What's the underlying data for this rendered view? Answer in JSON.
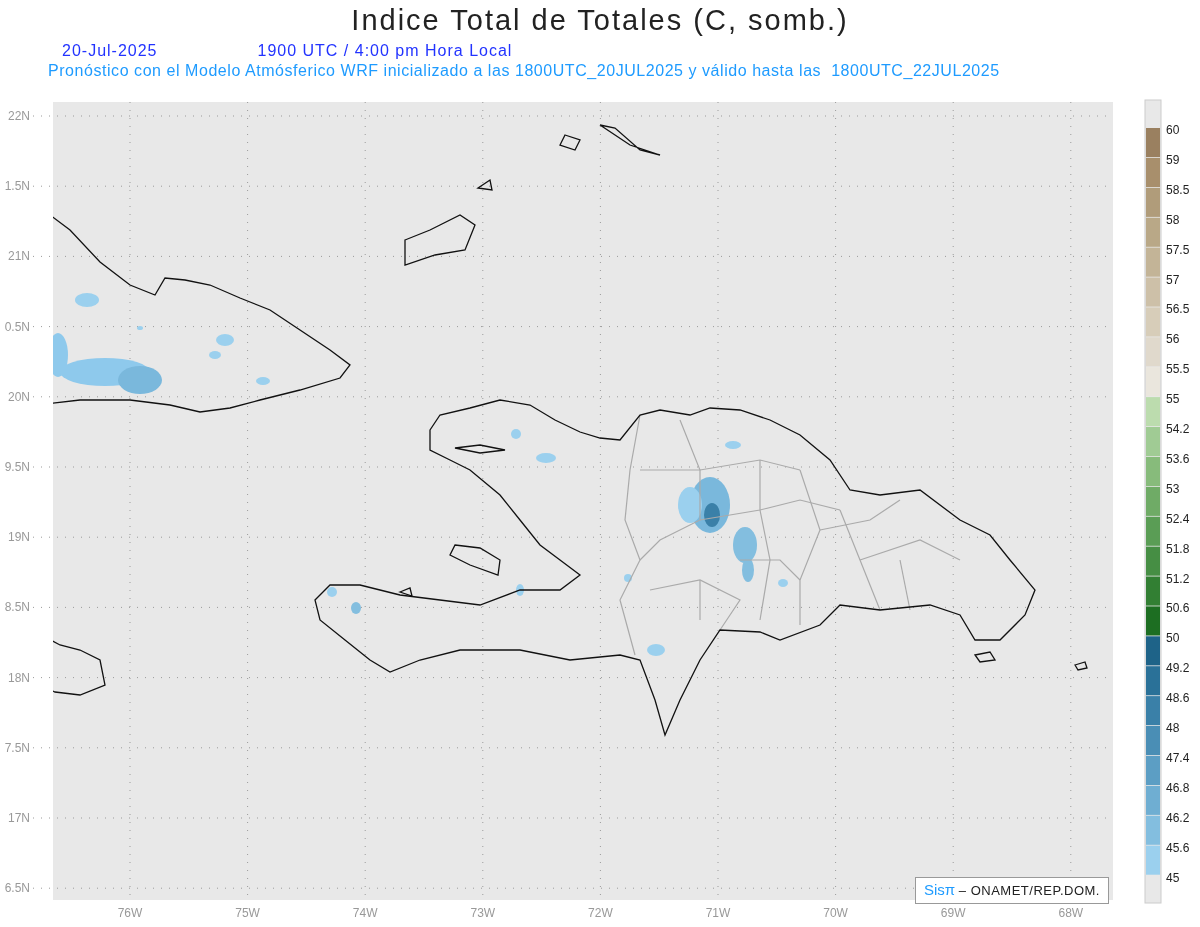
{
  "title": "Indice Total de Totales (C, somb.)",
  "date": "20-Jul-2025",
  "time_label": "1900 UTC / 4:00 pm Hora Local",
  "subtitle": "Pronóstico con el Modelo Atmósferico WRF inicializado a las 1800UTC_20JUL2025 y válido hasta las  1800UTC_22JUL2025",
  "map": {
    "y_labels": [
      "22N",
      "1.5N",
      "21N",
      "0.5N",
      "20N",
      "9.5N",
      "19N",
      "8.5N",
      "18N",
      "7.5N",
      "17N",
      "6.5N"
    ],
    "x_labels": [
      "76W",
      "75W",
      "74W",
      "73W",
      "72W",
      "71W",
      "70W",
      "69W",
      "68W"
    ]
  },
  "colorbar": {
    "labels": [
      "60",
      "59",
      "58.5",
      "58",
      "57.5",
      "57",
      "56.5",
      "56",
      "55.5",
      "55",
      "54.2",
      "53.6",
      "53",
      "52.4",
      "51.8",
      "51.2",
      "50.6",
      "50",
      "49.2",
      "48.6",
      "48",
      "47.4",
      "46.8",
      "46.2",
      "45.6",
      "45"
    ],
    "segments": [
      {
        "color": "#9a8060"
      },
      {
        "color": "#a88f6c"
      },
      {
        "color": "#b09c7a"
      },
      {
        "color": "#b9a887"
      },
      {
        "color": "#c3b497"
      },
      {
        "color": "#cdc0a8"
      },
      {
        "color": "#d7cdb9"
      },
      {
        "color": "#e0d9cc"
      },
      {
        "color": "#eae6dd"
      },
      {
        "color": "#bcdcae"
      },
      {
        "color": "#a0cb94"
      },
      {
        "color": "#87bb7b"
      },
      {
        "color": "#6fab66"
      },
      {
        "color": "#5a9d55"
      },
      {
        "color": "#468e44"
      },
      {
        "color": "#327f33"
      },
      {
        "color": "#1d6e22"
      },
      {
        "color": "#1e6388"
      },
      {
        "color": "#2a7198"
      },
      {
        "color": "#3a80a8"
      },
      {
        "color": "#4a8eb5"
      },
      {
        "color": "#5c9ec4"
      },
      {
        "color": "#6faed2"
      },
      {
        "color": "#83bedf"
      },
      {
        "color": "#9bd0ee"
      }
    ]
  },
  "credit": {
    "brand": "Sisπ",
    "text": "– ONAMET/REP.DOM."
  }
}
